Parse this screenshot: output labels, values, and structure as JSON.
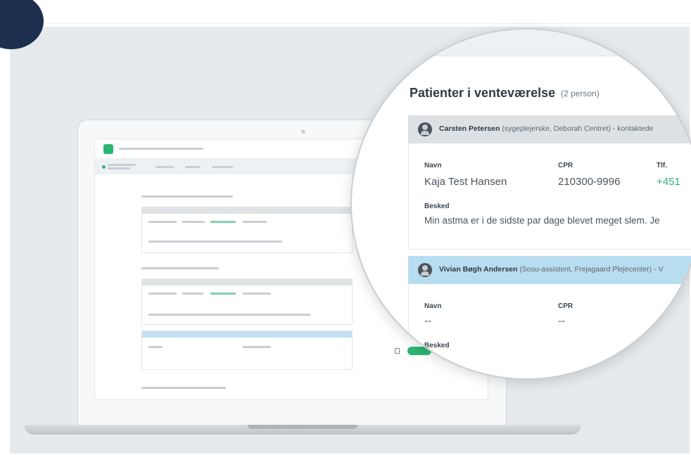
{
  "magnified": {
    "section_title": "Patienter i venteværelse",
    "section_count": "(2 person)",
    "patients": [
      {
        "header_name": "Carsten Petersen",
        "header_detail": " (sygeplejerske, Deborah Centret) - kontaktede",
        "col_name_label": "Navn",
        "col_cpr_label": "CPR",
        "col_phone_label": "Tlf.",
        "name": "Kaja Test Hansen",
        "cpr": "210300-9996",
        "phone": "+451",
        "message_label": "Besked",
        "message": "Min astma er i de sidste par dage blevet meget slem. Je"
      },
      {
        "header_name": "Vivian Bøgh Andersen",
        "header_detail": " (Sosu-assistent, Frejagaard Plejecenter) - V",
        "col_name_label": "Navn",
        "col_cpr_label": "CPR",
        "name": "--",
        "cpr": "--",
        "message_label": "Besked"
      }
    ]
  },
  "colors": {
    "accent_green": "#2bb673",
    "band_blue": "#b8dcf0",
    "band_grey": "#dde1e4",
    "navy_blob": "#1c2f4e"
  }
}
